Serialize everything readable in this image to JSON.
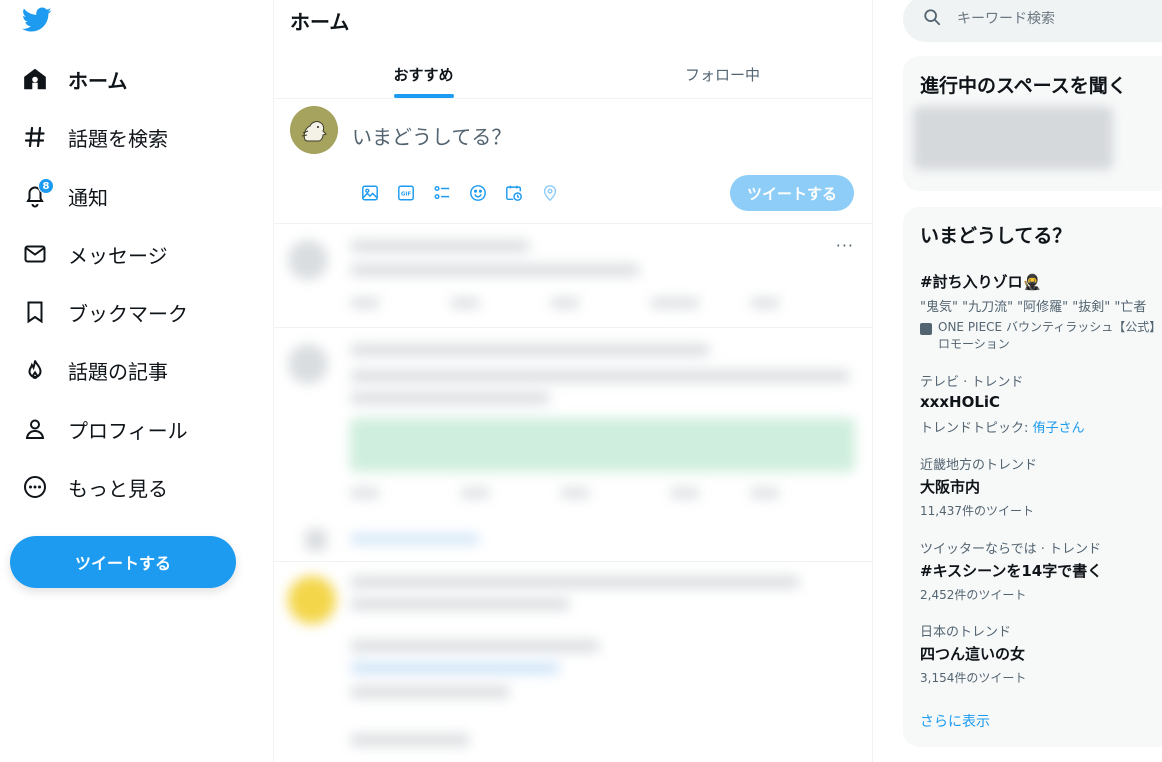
{
  "sidebar": {
    "logo_icon": "twitter-bird-icon",
    "items": [
      {
        "label": "ホーム",
        "icon": "home-icon",
        "active": true
      },
      {
        "label": "話題を検索",
        "icon": "hashtag-icon"
      },
      {
        "label": "通知",
        "icon": "bell-icon",
        "badge": "8"
      },
      {
        "label": "メッセージ",
        "icon": "envelope-icon"
      },
      {
        "label": "ブックマーク",
        "icon": "bookmark-icon"
      },
      {
        "label": "話題の記事",
        "icon": "flame-icon"
      },
      {
        "label": "プロフィール",
        "icon": "person-icon"
      },
      {
        "label": "もっと見る",
        "icon": "more-circle-icon"
      }
    ],
    "tweet_button": "ツイートする"
  },
  "main": {
    "title": "ホーム",
    "tabs": [
      {
        "label": "おすすめ",
        "active": true
      },
      {
        "label": "フォロー中",
        "active": false
      }
    ],
    "composer": {
      "placeholder": "いまどうしてる？",
      "tools": [
        "image-icon",
        "gif-icon",
        "poll-icon",
        "emoji-icon",
        "schedule-icon",
        "location-icon"
      ],
      "submit": "ツイートする"
    },
    "tweet_more": "···"
  },
  "right": {
    "search": {
      "placeholder": "キーワード検索"
    },
    "spaces": {
      "title": "進行中のスペースを聞く"
    },
    "trends": {
      "title": "いまどうしてる？",
      "promoted": {
        "name": "#討ち入りゾロ🥷",
        "description": "\"鬼気\" \"九刀流\" \"阿修羅\" \"抜剣\" \"亡者",
        "promoter_line1": "ONE PIECE バウンティラッシュ【公式】",
        "promoter_line2": "ロモーション"
      },
      "items": [
        {
          "context": "テレビ · トレンド",
          "name": "xxxHOLiC",
          "topic_prefix": "トレンドトピック: ",
          "topic": "侑子さん"
        },
        {
          "context": "近畿地方のトレンド",
          "name": "大阪市内",
          "count": "11,437件のツイート"
        },
        {
          "context": "ツイッターならでは · トレンド",
          "name": "#キスシーンを14字で書く",
          "count": "2,452件のツイート"
        },
        {
          "context": "日本のトレンド",
          "name": "四つん這いの女",
          "count": "3,154件のツイート"
        }
      ],
      "show_more": "さらに表示"
    }
  },
  "colors": {
    "accent": "#1d9bf0",
    "accent_disabled": "#8ecdf8",
    "text": "#0f1419",
    "secondary": "#536471"
  }
}
